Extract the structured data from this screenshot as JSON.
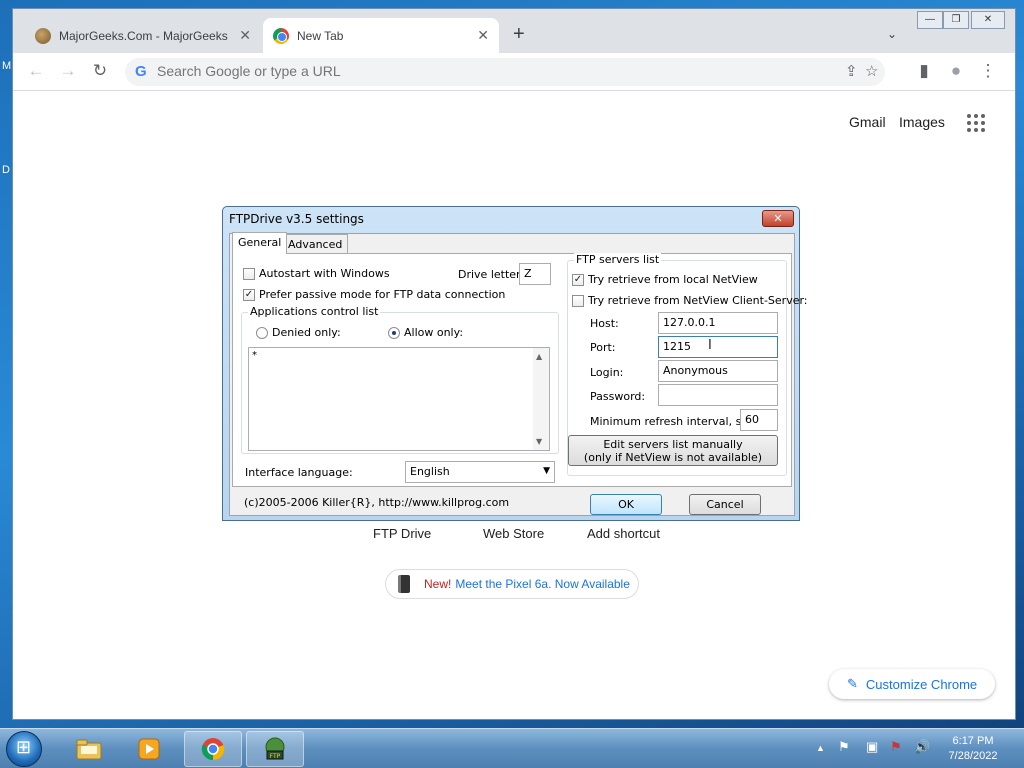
{
  "desktop": {
    "fragment1": "M",
    "fragment2": "D"
  },
  "browser": {
    "tabs": [
      {
        "title": "MajorGeeks.Com - MajorGeeks",
        "icon": "majorgeeks-favicon"
      },
      {
        "title": "New Tab",
        "icon": "chrome-favicon"
      }
    ],
    "tab_close_glyph": "✕",
    "new_tab_glyph": "+",
    "tab_list_glyph": "⌄",
    "window_controls": {
      "minimize": "—",
      "maximize": "❐",
      "close": "✕"
    },
    "nav": {
      "back": "←",
      "forward": "→",
      "reload": "↻"
    },
    "omnibox": {
      "google_glyph": "G",
      "placeholder": "Search Google or type a URL"
    },
    "toolbar_icons": {
      "share": "⇪",
      "bookmark": "☆",
      "side_panel": "▮",
      "profile": "●",
      "menu": "⋮"
    },
    "ntp": {
      "gmail": "Gmail",
      "images": "Images",
      "shortcuts": [
        "FTP Drive",
        "Web Store",
        "Add shortcut"
      ],
      "promo_new": "New!",
      "promo_text": "Meet the Pixel 6a. Now Available",
      "customize_icon": "✎",
      "customize": "Customize Chrome"
    }
  },
  "dialog": {
    "title": "FTPDrive v3.5 settings",
    "close_glyph": "✕",
    "tabs": [
      "General",
      "Advanced"
    ],
    "autostart_label": "Autostart with Windows",
    "autostart_checked": false,
    "drive_letter_label": "Drive letter:",
    "drive_letter_value": "Z",
    "passive_label": "Prefer passive mode for FTP data connection",
    "passive_checked": true,
    "check_glyph": "✓",
    "apps_group_caption": "Applications control list",
    "denied_label": "Denied only:",
    "allow_label": "Allow only:",
    "allow_selected": true,
    "apps_list_value": "*",
    "scroll_up": "▲",
    "scroll_down": "▼",
    "language_label": "Interface language:",
    "language_value": "English",
    "dropdown_glyph": "▼",
    "servers_caption": "FTP servers list",
    "local_netview_label": "Try retrieve from local NetView",
    "local_netview_checked": true,
    "client_server_label": "Try retrieve from NetView Client-Server:",
    "client_server_checked": false,
    "host_label": "Host:",
    "host_value": "127.0.0.1",
    "port_label": "Port:",
    "port_value": "1215",
    "login_label": "Login:",
    "login_value": "Anonymous",
    "password_label": "Password:",
    "password_value": "",
    "refresh_label": "Minimum refresh interval, sec:",
    "refresh_value": "60",
    "edit_servers_line1": "Edit servers list manually",
    "edit_servers_line2": "(only if NetView is not available)",
    "copyright": "(c)2005-2006 Killer{R}, http://www.killprog.com",
    "ok": "OK",
    "cancel": "Cancel",
    "text_cursor_glyph": "I"
  },
  "taskbar": {
    "apps": [
      "start",
      "explorer",
      "media-player",
      "chrome",
      "ftpdrive"
    ],
    "tray": {
      "show_hidden": "▲",
      "volume": "🔊",
      "network": "▣",
      "action_center": "⚑"
    },
    "time": "6:17 PM",
    "date": "7/28/2022"
  }
}
